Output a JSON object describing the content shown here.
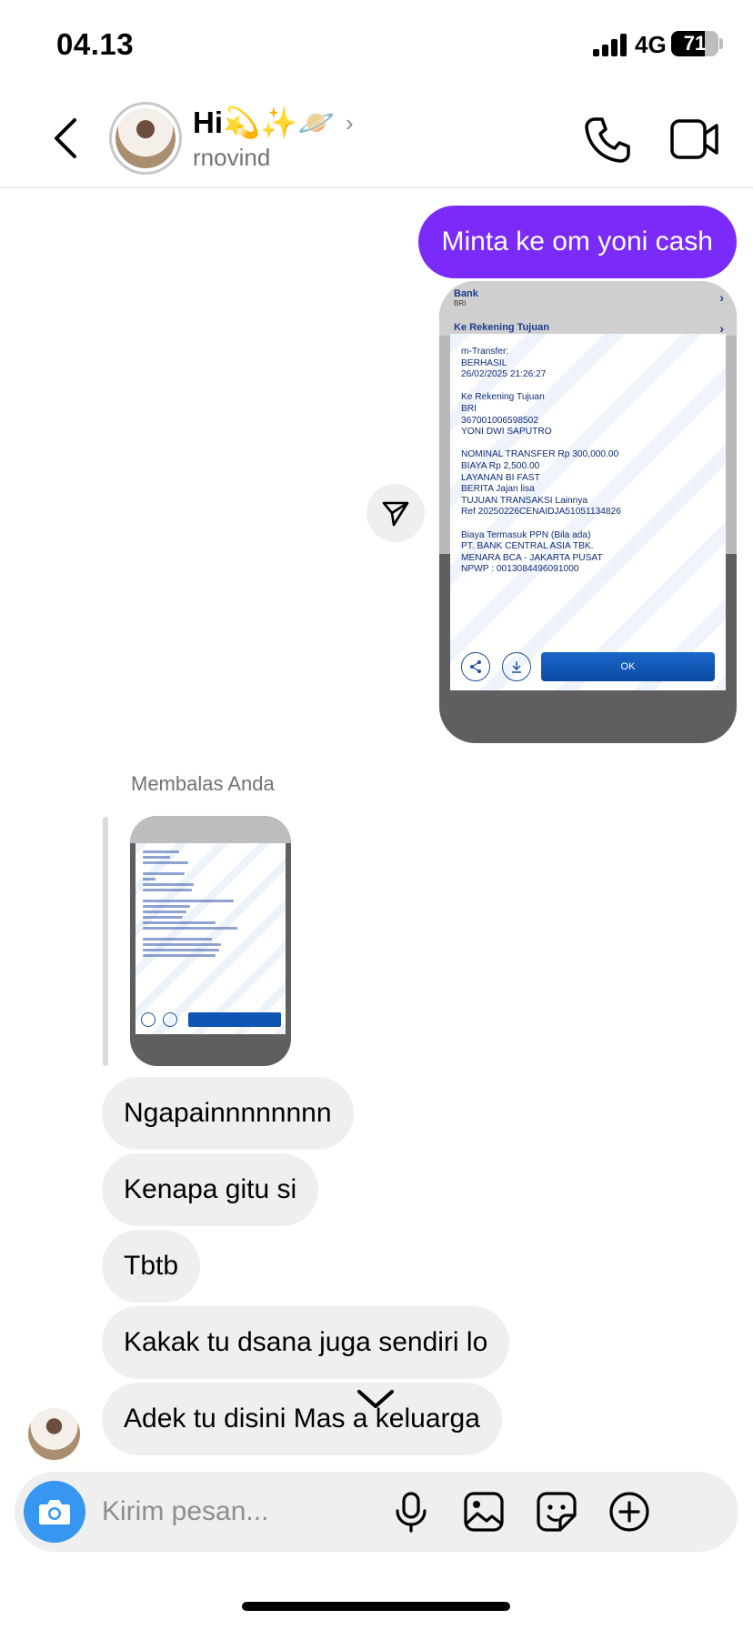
{
  "status_bar": {
    "time": "04.13",
    "network": "4G",
    "battery": "71",
    "battery_level": 0.71
  },
  "header": {
    "contact_name": "Hi💫✨🪐",
    "username": "rnovind",
    "chevron": "›"
  },
  "messages": {
    "sent_text": "Minta ke om yoni cash",
    "receipt": {
      "bank_label": "Bank",
      "bank_sub": "BRI",
      "rekening_label": "Ke Rekening Tujuan",
      "lines": [
        "m-Transfer:",
        "BERHASIL",
        "26/02/2025 21:26:27",
        "",
        "Ke Rekening Tujuan",
        "BRI",
        "367001006598502",
        "YONI DWI SAPUTRO",
        "",
        "NOMINAL TRANSFER Rp 300,000.00",
        "BIAYA Rp 2,500.00",
        "LAYANAN BI FAST",
        "BERITA Jajan lisa",
        "TUJUAN TRANSAKSI Lainnya",
        "Ref 20250226CENAIDJA51051134826",
        "",
        "Biaya Termasuk PPN (Bila ada)",
        "PT. BANK CENTRAL ASIA TBK.",
        "MENARA BCA - JAKARTA PUSAT",
        "NPWP : 0013084496091000"
      ],
      "ok_label": "OK"
    },
    "reply_label": "Membalas Anda",
    "received": [
      "Ngapainnnnnnnn",
      "Kenapa gitu si",
      "Tbtb",
      "Kakak tu dsana juga sendiri lo",
      "Adek tu disini Mas    a keluarga"
    ]
  },
  "composer": {
    "placeholder": "Kirim pesan..."
  },
  "icons": {
    "back": "chevron-left-icon",
    "call": "phone-icon",
    "video": "video-camera-icon",
    "send": "paper-plane-icon",
    "camera": "camera-icon",
    "mic": "microphone-icon",
    "gallery": "image-icon",
    "sticker": "sticker-icon",
    "plus": "plus-circle-icon",
    "scroll_down": "chevron-down-icon"
  },
  "colors": {
    "sent_bubble": "#7b2bf9",
    "received_bubble": "#efefef",
    "camera_button": "#3797f0",
    "bca_button": "#0d4aa3"
  }
}
